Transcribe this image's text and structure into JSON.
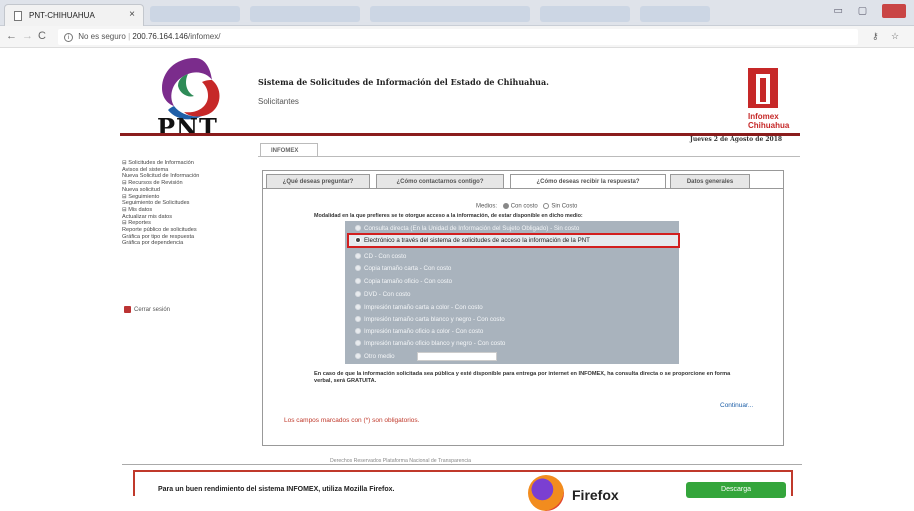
{
  "browser": {
    "tab_title": "PNT-CHIHUAHUA",
    "tab_close": "×",
    "not_secure": "No es seguro",
    "url_host": "200.76.164.146",
    "url_path": "/infomex/"
  },
  "header": {
    "logo_text": "PNT",
    "system_title": "Sistema de Solicitudes de Información del Estado de Chihuahua.",
    "subtitle": "Solicitantes",
    "infomex_line1": "Infomex",
    "infomex_line2": "Chihuahua",
    "date": "Jueves 2 de Agosto de 2018",
    "main_tab": "INFOMEX"
  },
  "sidebar": {
    "items": [
      "⊟ Solicitudes de Información",
      "Avisos del sistema",
      "Nueva Solicitud de Información",
      "⊟ Recursos de Revisión",
      "Nueva solicitud",
      "⊟ Seguimiento",
      "Seguimiento de Solicitudes",
      "⊟ Mis datos",
      "Actualizar mis datos",
      "⊟ Reportes",
      "Reporte público de solicitudes",
      "Gráfica por tipo de respuesta",
      "Gráfica por dependencia"
    ],
    "logout": "Cerrar sesión"
  },
  "form": {
    "tabs": [
      "¿Qué deseas preguntar?",
      "¿Cómo contactarnos contigo?",
      "¿Cómo deseas recibir la respuesta?",
      "Datos generales"
    ],
    "medios_label": "Medios:",
    "medios_con_costo": "Con costo",
    "medios_sin_costo": "Sin Costo",
    "modalidad_label": "Modalidad en la que prefieres se te otorgue acceso a la información, de estar disponible en dicho medio:",
    "options": [
      "Consulta directa (En la Unidad de Información del Sujeto Obligado) - Sin costo",
      "Electrónico a través del sistema de solicitudes de acceso la información de la PNT",
      "CD - Con costo",
      "Copia tamaño carta - Con costo",
      "Copia tamaño oficio - Con costo",
      "DVD - Con costo",
      "Impresión tamaño carta a color - Con costo",
      "Impresión tamaño carta blanco y negro - Con costo",
      "Impresión tamaño oficio a color - Con costo",
      "Impresión tamaño oficio blanco y negro - Con costo",
      "Otro medio"
    ],
    "note": "En caso de que la información solicitada sea pública y esté disponible para entrega por internet en INFOMEX, ha consulta directa o se proporcione en forma verbal, será GRATUITA.",
    "continue": "Continuar...",
    "required_note": "Los campos marcados con (*) son obligatorios."
  },
  "footer": {
    "rights": "Derechos Reservados Plataforma Nacional de Transparencia",
    "banner_text": "Para un buen rendimiento del sistema INFOMEX, utiliza Mozilla Firefox.",
    "firefox_word": "Firefox",
    "download": "Descarga"
  }
}
